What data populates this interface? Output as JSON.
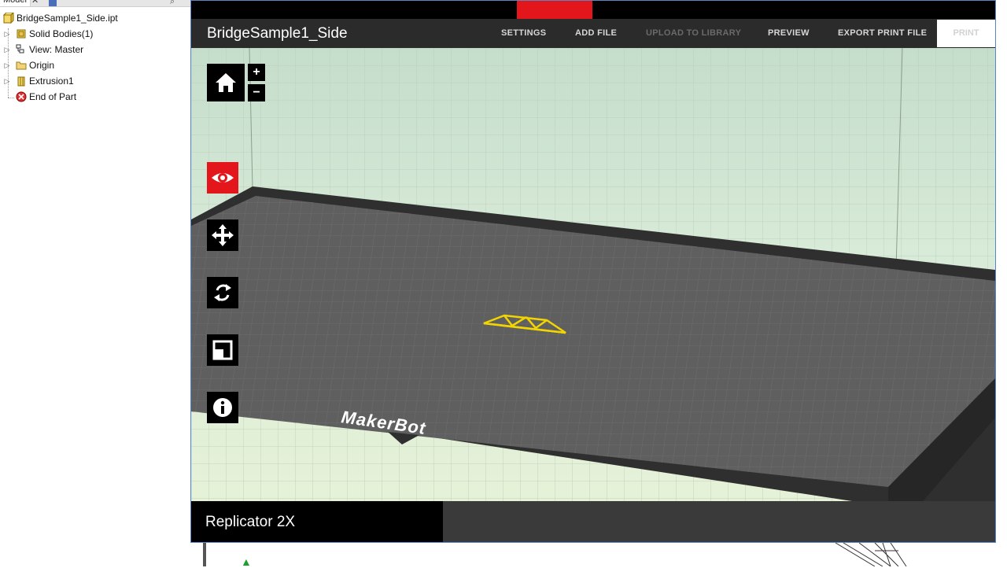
{
  "inventor": {
    "browser_tab": "Model",
    "tree": [
      {
        "label": "BridgeSample1_Side.ipt",
        "icon": "part-icon"
      },
      {
        "label": "Solid Bodies(1)",
        "icon": "solid-bodies-icon"
      },
      {
        "label": "View: Master",
        "icon": "view-icon"
      },
      {
        "label": "Origin",
        "icon": "folder-icon"
      },
      {
        "label": "Extrusion1",
        "icon": "extrusion-icon"
      },
      {
        "label": "End of Part",
        "icon": "end-of-part-icon"
      }
    ]
  },
  "makerbot": {
    "title": "BridgeSample1_Side",
    "nav": {
      "settings": "SETTINGS",
      "add_file": "ADD FILE",
      "upload": "UPLOAD TO LIBRARY",
      "preview": "PREVIEW",
      "export": "EXPORT PRINT FILE",
      "print": "PRINT"
    },
    "zoom_in": "+",
    "zoom_out": "−",
    "bed_logo": "MakerBot",
    "printer": "Replicator 2X",
    "colors": {
      "accent_red": "#e3161b",
      "model_yellow": "#f2d400",
      "plate_gray": "#5f5f5f"
    }
  }
}
